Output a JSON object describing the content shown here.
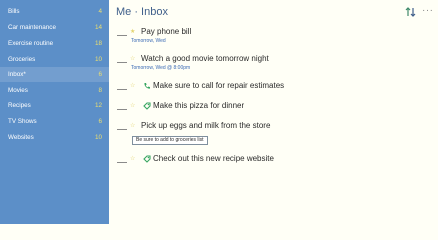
{
  "sidebar": {
    "lists": [
      {
        "name": "Bills",
        "count": "4"
      },
      {
        "name": "Car maintenance",
        "count": "14"
      },
      {
        "name": "Exercise routine",
        "count": "18"
      },
      {
        "name": "Groceries",
        "count": "10"
      },
      {
        "name": "Inbox*",
        "count": "6"
      },
      {
        "name": "Movies",
        "count": "8"
      },
      {
        "name": "Recipes",
        "count": "12"
      },
      {
        "name": "TV Shows",
        "count": "6"
      },
      {
        "name": "Websites",
        "count": "10"
      }
    ]
  },
  "header": {
    "title": "Me · Inbox",
    "sort_icon": "sort-arrows-icon",
    "more_icon": "more-options-icon",
    "more_glyph": "···"
  },
  "tasks": [
    {
      "title": "Pay phone bill",
      "due": "Tomorrow, Wed",
      "icon": "star-icon",
      "star_glyph": "★"
    },
    {
      "title": "Watch a good movie tomorrow night",
      "due": "Tomorrow, Wed @ 8:00pm",
      "icon": "star-icon",
      "star_glyph": "☆"
    },
    {
      "title": "Make sure to call for repair estimates",
      "icon": "phone-icon",
      "star_glyph": "☆"
    },
    {
      "title": "Make this pizza for dinner",
      "icon": "tag-icon",
      "star_glyph": "☆"
    },
    {
      "title": "Pick up eggs and milk from the store",
      "note": "Be sure to add to groceries list",
      "icon": "star-icon",
      "star_glyph": "☆"
    },
    {
      "title": "Check out this new recipe website",
      "icon": "tag-icon",
      "star_glyph": "☆"
    }
  ],
  "colors": {
    "sidebar": "#5c8fc8",
    "count": "#ecdf6e",
    "accent": "#3b6ab5",
    "background": "#fffff6",
    "icon_green": "#36a560"
  }
}
